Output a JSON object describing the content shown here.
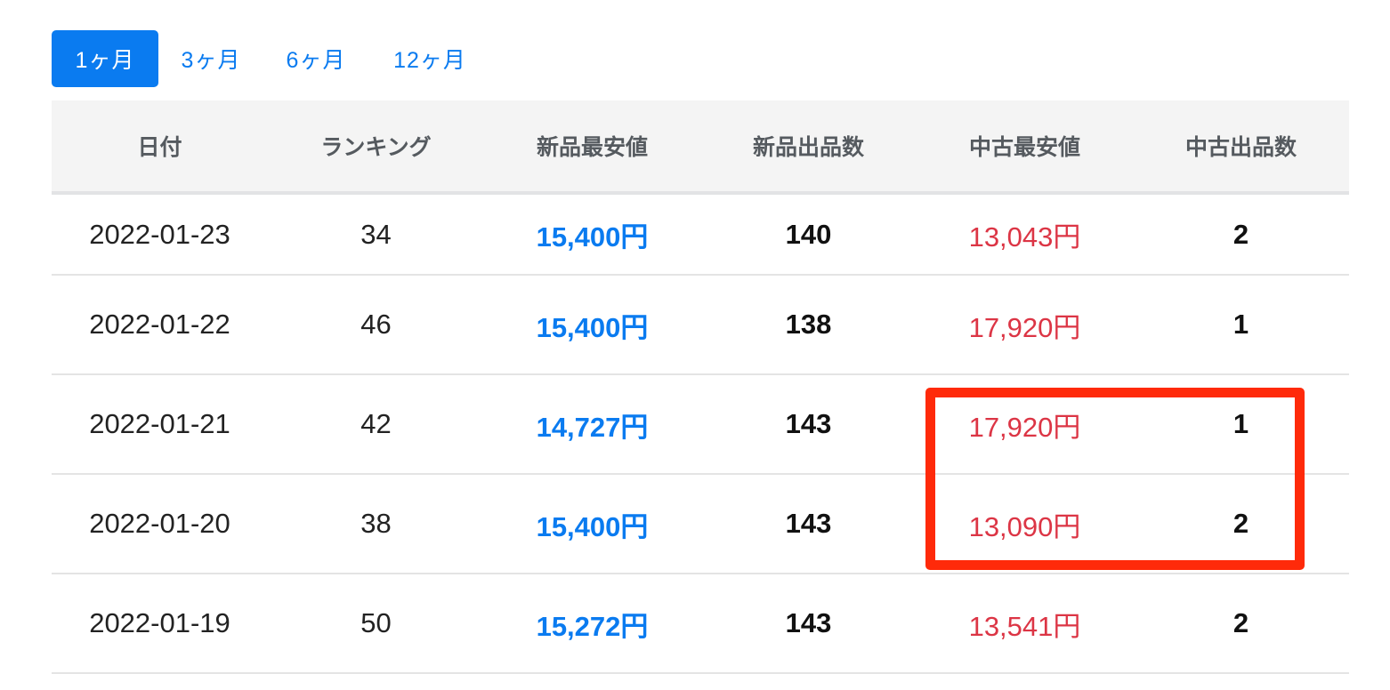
{
  "tabs": [
    {
      "label": "1ヶ月",
      "active": true
    },
    {
      "label": "3ヶ月",
      "active": false
    },
    {
      "label": "6ヶ月",
      "active": false
    },
    {
      "label": "12ヶ月",
      "active": false
    }
  ],
  "table": {
    "headers": [
      "日付",
      "ランキング",
      "新品最安値",
      "新品出品数",
      "中古最安値",
      "中古出品数"
    ],
    "rows": [
      [
        "2022-01-23",
        "34",
        "15,400円",
        "140",
        "13,043円",
        "2"
      ],
      [
        "2022-01-22",
        "46",
        "15,400円",
        "138",
        "17,920円",
        "1"
      ],
      [
        "2022-01-21",
        "42",
        "14,727円",
        "143",
        "17,920円",
        "1"
      ],
      [
        "2022-01-20",
        "38",
        "15,400円",
        "143",
        "13,090円",
        "2"
      ],
      [
        "2022-01-19",
        "50",
        "15,272円",
        "143",
        "13,541円",
        "2"
      ]
    ]
  },
  "colors": {
    "accent_blue": "#0a7bf0",
    "price_red": "#dc3545",
    "highlight_red": "#ff2a0a",
    "header_bg": "#f4f4f4"
  }
}
